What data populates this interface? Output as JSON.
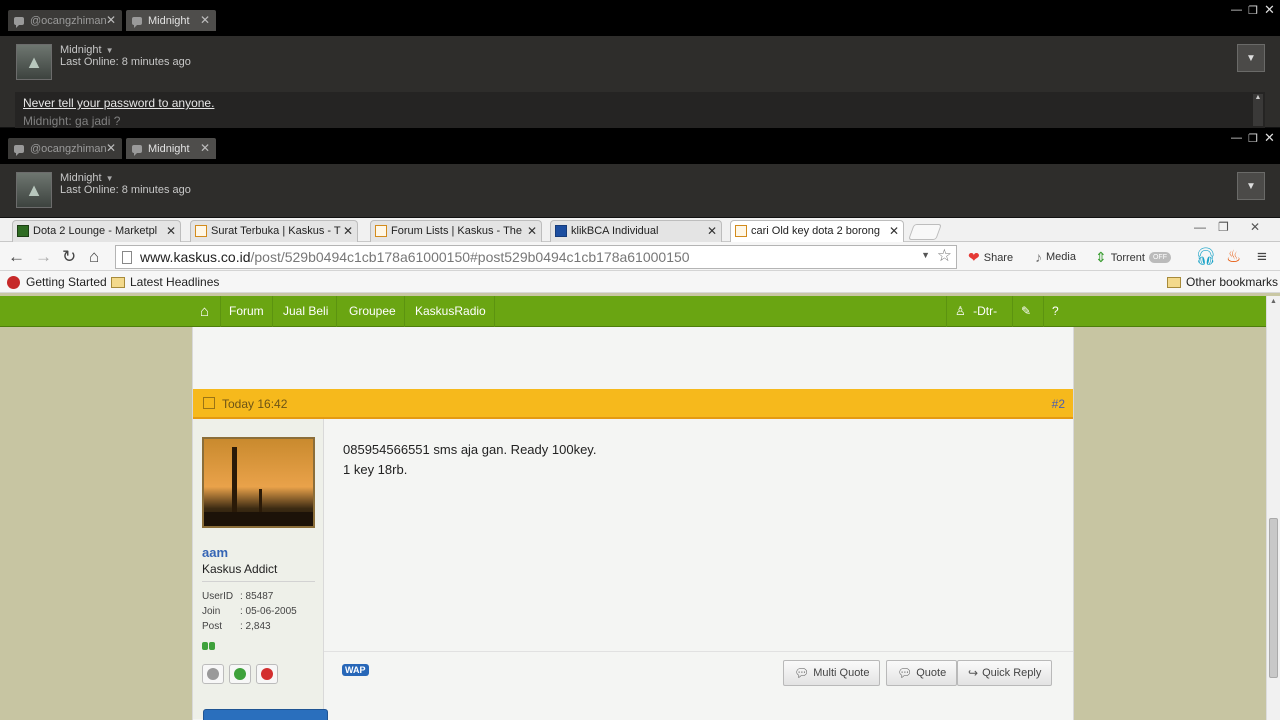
{
  "steam_chat_windows": [
    {
      "tabs": [
        {
          "label": "@ocangzhiman"
        },
        {
          "label": "Midnight"
        }
      ],
      "friend": {
        "name": "Midnight",
        "status": "Last Online: 8 minutes ago"
      },
      "chat": {
        "warning": "Never tell your password to anyone.",
        "last_message": "Midnight: ga jadi ?"
      }
    },
    {
      "tabs": [
        {
          "label": "@ocangzhiman"
        },
        {
          "label": "Midnight"
        }
      ],
      "friend": {
        "name": "Midnight",
        "status": "Last Online: 8 minutes ago"
      }
    }
  ],
  "browser": {
    "tabs": [
      {
        "title": "Dota 2 Lounge - Marketpl"
      },
      {
        "title": "Surat Terbuka | Kaskus - T"
      },
      {
        "title": "Forum Lists | Kaskus - The"
      },
      {
        "title": "klikBCA Individual"
      },
      {
        "title": "cari Old key dota 2 borong"
      }
    ],
    "url_host": "www.kaskus.co.id",
    "url_path": "/post/529b0494c1cb178a61000150#post529b0494c1cb178a61000150",
    "extensions": [
      {
        "label": "Share"
      },
      {
        "label": "Media"
      },
      {
        "label": "Torrent"
      }
    ],
    "toggle_label": "OFF",
    "bookmarks": [
      {
        "label": "Getting Started"
      },
      {
        "label": "Latest Headlines"
      }
    ],
    "other_bookmarks": "Other bookmarks"
  },
  "kaskus": {
    "nav": [
      "Forum",
      "Jual Beli",
      "Groupee",
      "KaskusRadio"
    ],
    "user_nav": "-Dtr-",
    "post": {
      "time": "Today 16:42",
      "number": "#2",
      "body_lines": [
        "085954566551 sms aja gan. Ready 100key.",
        "1 key 18rb."
      ]
    },
    "poster": {
      "name": "aam",
      "rank": "Kaskus Addict",
      "info": [
        {
          "key": "UserID",
          "value": ": 85487"
        },
        {
          "key": "Join",
          "value": ": 05-06-2005"
        },
        {
          "key": "Post",
          "value": ": 2,843"
        }
      ]
    },
    "wap_label": "WAP",
    "buttons": {
      "multi_quote": "Multi Quote",
      "quote": "Quote",
      "quick_reply": "Quick Reply"
    }
  },
  "colors": {
    "kaskus_green": "#6aa512",
    "post_header": "#f6b91c",
    "username": "#3565b5"
  }
}
